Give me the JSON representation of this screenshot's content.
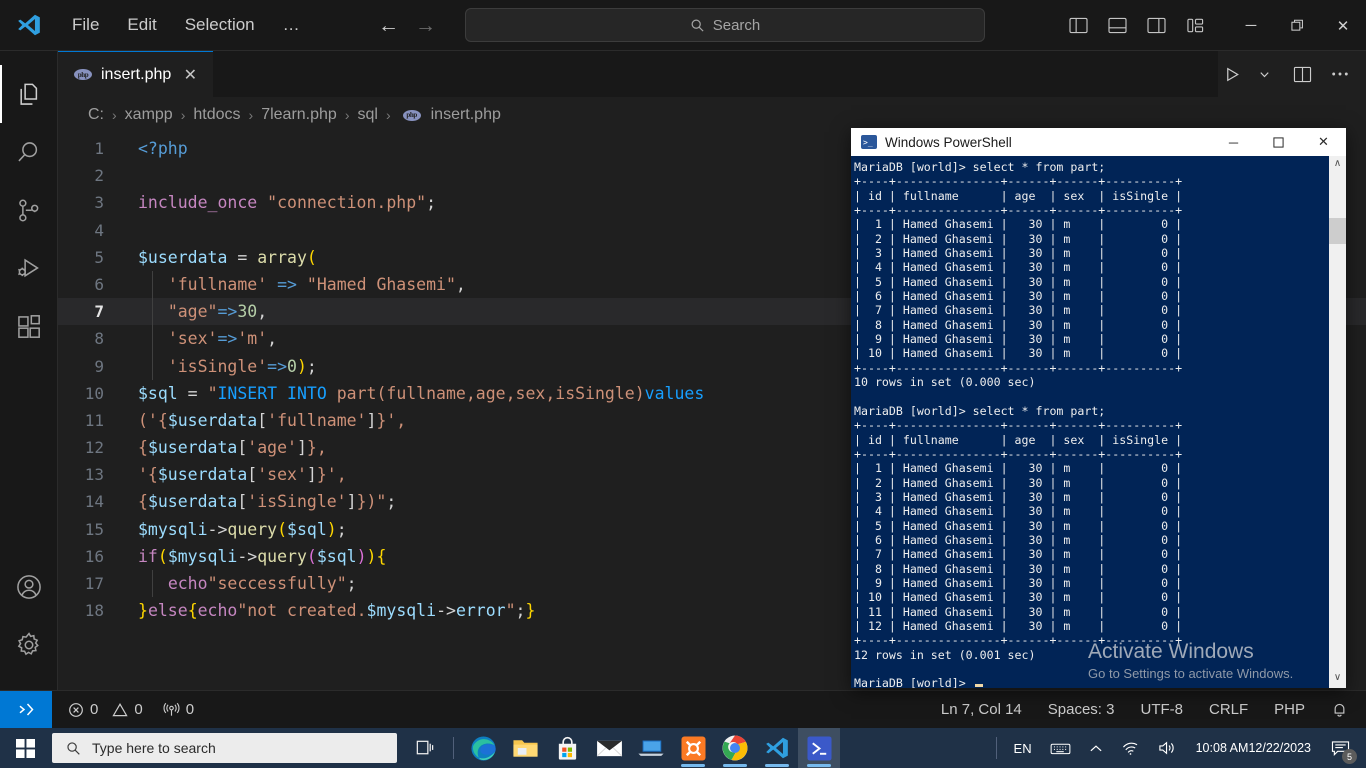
{
  "titlebar": {
    "menu": [
      "File",
      "Edit",
      "Selection",
      "…"
    ],
    "search_placeholder": "Search",
    "search_label": "Search",
    "back_arrow": "←",
    "forward_arrow": "→",
    "minimize": "─",
    "maximize": "❐",
    "close": "✕"
  },
  "activitybar": {
    "items": [
      {
        "name": "explorer",
        "label": "Explorer"
      },
      {
        "name": "search",
        "label": "Search"
      },
      {
        "name": "source-control",
        "label": "Source Control"
      },
      {
        "name": "run-debug",
        "label": "Run and Debug"
      },
      {
        "name": "extensions",
        "label": "Extensions"
      }
    ],
    "bottom": [
      {
        "name": "accounts",
        "label": "Accounts"
      },
      {
        "name": "settings",
        "label": "Manage"
      }
    ]
  },
  "tabs": [
    {
      "label": "insert.php",
      "icon": "php-icon",
      "close": "✕",
      "active": true
    }
  ],
  "breadcrumb": [
    "C:",
    "xampp",
    "htdocs",
    "7learn.php",
    "sql",
    "insert.php"
  ],
  "breadcrumb_separator": "›",
  "editor": {
    "lines": [
      {
        "num": "1",
        "current": false,
        "guide": false,
        "tokens": [
          {
            "c": "t-blue",
            "t": "<?php"
          }
        ]
      },
      {
        "num": "2",
        "current": false,
        "guide": false,
        "tokens": []
      },
      {
        "num": "3",
        "current": false,
        "guide": false,
        "tokens": [
          {
            "c": "t-kw",
            "t": "include_once"
          },
          {
            "c": "t-plain",
            "t": " "
          },
          {
            "c": "t-str",
            "t": "\"connection.php\""
          },
          {
            "c": "t-plain",
            "t": ";"
          }
        ]
      },
      {
        "num": "4",
        "current": false,
        "guide": false,
        "tokens": []
      },
      {
        "num": "5",
        "current": false,
        "guide": false,
        "tokens": [
          {
            "c": "t-var",
            "t": "$userdata"
          },
          {
            "c": "t-plain",
            "t": " = "
          },
          {
            "c": "t-fn",
            "t": "array"
          },
          {
            "c": "t-y",
            "t": "("
          }
        ]
      },
      {
        "num": "6",
        "current": false,
        "guide": true,
        "tokens": [
          {
            "c": "t-plain",
            "t": "   "
          },
          {
            "c": "t-str",
            "t": "'fullname'"
          },
          {
            "c": "t-plain",
            "t": " "
          },
          {
            "c": "t-blue",
            "t": "=>"
          },
          {
            "c": "t-plain",
            "t": " "
          },
          {
            "c": "t-str",
            "t": "\"Hamed Ghasemi\""
          },
          {
            "c": "t-plain",
            "t": ","
          }
        ]
      },
      {
        "num": "7",
        "current": true,
        "guide": true,
        "tokens": [
          {
            "c": "t-plain",
            "t": "   "
          },
          {
            "c": "t-str",
            "t": "\"age\""
          },
          {
            "c": "t-blue",
            "t": "=>"
          },
          {
            "c": "t-num",
            "t": "30"
          },
          {
            "c": "t-plain",
            "t": ","
          }
        ]
      },
      {
        "num": "8",
        "current": false,
        "guide": true,
        "tokens": [
          {
            "c": "t-plain",
            "t": "   "
          },
          {
            "c": "t-str",
            "t": "'sex'"
          },
          {
            "c": "t-blue",
            "t": "=>"
          },
          {
            "c": "t-str",
            "t": "'m'"
          },
          {
            "c": "t-plain",
            "t": ","
          }
        ]
      },
      {
        "num": "9",
        "current": false,
        "guide": true,
        "tokens": [
          {
            "c": "t-plain",
            "t": "   "
          },
          {
            "c": "t-str",
            "t": "'isSingle'"
          },
          {
            "c": "t-blue",
            "t": "=>"
          },
          {
            "c": "t-num",
            "t": "0"
          },
          {
            "c": "t-y",
            "t": ")"
          },
          {
            "c": "t-plain",
            "t": ";"
          }
        ]
      },
      {
        "num": "10",
        "current": false,
        "guide": false,
        "tokens": [
          {
            "c": "t-var",
            "t": "$sql"
          },
          {
            "c": "t-plain",
            "t": " = "
          },
          {
            "c": "t-str",
            "t": "\""
          },
          {
            "c": "t-c",
            "t": "INSERT INTO"
          },
          {
            "c": "t-str",
            "t": " part(fullname,age,sex,isSingle)"
          },
          {
            "c": "t-c",
            "t": "values"
          }
        ]
      },
      {
        "num": "11",
        "current": false,
        "guide": false,
        "tokens": [
          {
            "c": "t-str",
            "t": "('{"
          },
          {
            "c": "t-var",
            "t": "$userdata"
          },
          {
            "c": "t-plain",
            "t": "["
          },
          {
            "c": "t-str",
            "t": "'fullname'"
          },
          {
            "c": "t-plain",
            "t": "]"
          },
          {
            "c": "t-str",
            "t": "}',"
          }
        ]
      },
      {
        "num": "12",
        "current": false,
        "guide": false,
        "tokens": [
          {
            "c": "t-str",
            "t": "{"
          },
          {
            "c": "t-var",
            "t": "$userdata"
          },
          {
            "c": "t-plain",
            "t": "["
          },
          {
            "c": "t-str",
            "t": "'age'"
          },
          {
            "c": "t-plain",
            "t": "]"
          },
          {
            "c": "t-str",
            "t": "},"
          }
        ]
      },
      {
        "num": "13",
        "current": false,
        "guide": false,
        "tokens": [
          {
            "c": "t-str",
            "t": "'{"
          },
          {
            "c": "t-var",
            "t": "$userdata"
          },
          {
            "c": "t-plain",
            "t": "["
          },
          {
            "c": "t-str",
            "t": "'sex'"
          },
          {
            "c": "t-plain",
            "t": "]"
          },
          {
            "c": "t-str",
            "t": "}',"
          }
        ]
      },
      {
        "num": "14",
        "current": false,
        "guide": false,
        "tokens": [
          {
            "c": "t-str",
            "t": "{"
          },
          {
            "c": "t-var",
            "t": "$userdata"
          },
          {
            "c": "t-plain",
            "t": "["
          },
          {
            "c": "t-str",
            "t": "'isSingle'"
          },
          {
            "c": "t-plain",
            "t": "]"
          },
          {
            "c": "t-str",
            "t": "})\""
          },
          {
            "c": "t-plain",
            "t": ";"
          }
        ]
      },
      {
        "num": "15",
        "current": false,
        "guide": false,
        "tokens": [
          {
            "c": "t-var",
            "t": "$mysqli"
          },
          {
            "c": "t-plain",
            "t": "->"
          },
          {
            "c": "t-fn",
            "t": "query"
          },
          {
            "c": "t-y",
            "t": "("
          },
          {
            "c": "t-var",
            "t": "$sql"
          },
          {
            "c": "t-y",
            "t": ")"
          },
          {
            "c": "t-plain",
            "t": ";"
          }
        ]
      },
      {
        "num": "16",
        "current": false,
        "guide": false,
        "tokens": [
          {
            "c": "t-kw",
            "t": "if"
          },
          {
            "c": "t-y",
            "t": "("
          },
          {
            "c": "t-var",
            "t": "$mysqli"
          },
          {
            "c": "t-plain",
            "t": "->"
          },
          {
            "c": "t-fn",
            "t": "query"
          },
          {
            "c": "t-m",
            "t": "("
          },
          {
            "c": "t-var",
            "t": "$sql"
          },
          {
            "c": "t-m",
            "t": ")"
          },
          {
            "c": "t-y",
            "t": ")"
          },
          {
            "c": "t-y",
            "t": "{"
          }
        ]
      },
      {
        "num": "17",
        "current": false,
        "guide": true,
        "tokens": [
          {
            "c": "t-plain",
            "t": "   "
          },
          {
            "c": "t-kw",
            "t": "echo"
          },
          {
            "c": "t-str",
            "t": "\"seccessfully\""
          },
          {
            "c": "t-plain",
            "t": ";"
          }
        ]
      },
      {
        "num": "18",
        "current": false,
        "guide": false,
        "tokens": [
          {
            "c": "t-y",
            "t": "}"
          },
          {
            "c": "t-kw",
            "t": "else"
          },
          {
            "c": "t-y",
            "t": "{"
          },
          {
            "c": "t-kw",
            "t": "echo"
          },
          {
            "c": "t-str",
            "t": "\"not created."
          },
          {
            "c": "t-var",
            "t": "$mysqli"
          },
          {
            "c": "t-plain",
            "t": "->"
          },
          {
            "c": "t-var",
            "t": "error"
          },
          {
            "c": "t-str",
            "t": "\""
          },
          {
            "c": "t-plain",
            "t": ";"
          },
          {
            "c": "t-y",
            "t": "}"
          }
        ]
      }
    ]
  },
  "statusbar": {
    "errors": "0",
    "warnings": "0",
    "ports": "0",
    "position": "Ln 7, Col 14",
    "spaces": "Spaces: 3",
    "encoding": "UTF-8",
    "eol": "CRLF",
    "language": "PHP"
  },
  "powershell": {
    "title": "Windows PowerShell",
    "minimize": "─",
    "maximize": "☐",
    "close": "✕",
    "scroll_up": "∧",
    "scroll_down": "∨",
    "content": "MariaDB [world]> select * from part;\n+----+---------------+------+------+----------+\n| id | fullname      | age  | sex  | isSingle |\n+----+---------------+------+------+----------+\n|  1 | Hamed Ghasemi |   30 | m    |        0 |\n|  2 | Hamed Ghasemi |   30 | m    |        0 |\n|  3 | Hamed Ghasemi |   30 | m    |        0 |\n|  4 | Hamed Ghasemi |   30 | m    |        0 |\n|  5 | Hamed Ghasemi |   30 | m    |        0 |\n|  6 | Hamed Ghasemi |   30 | m    |        0 |\n|  7 | Hamed Ghasemi |   30 | m    |        0 |\n|  8 | Hamed Ghasemi |   30 | m    |        0 |\n|  9 | Hamed Ghasemi |   30 | m    |        0 |\n| 10 | Hamed Ghasemi |   30 | m    |        0 |\n+----+---------------+------+------+----------+\n10 rows in set (0.000 sec)\n\nMariaDB [world]> select * from part;\n+----+---------------+------+------+----------+\n| id | fullname      | age  | sex  | isSingle |\n+----+---------------+------+------+----------+\n|  1 | Hamed Ghasemi |   30 | m    |        0 |\n|  2 | Hamed Ghasemi |   30 | m    |        0 |\n|  3 | Hamed Ghasemi |   30 | m    |        0 |\n|  4 | Hamed Ghasemi |   30 | m    |        0 |\n|  5 | Hamed Ghasemi |   30 | m    |        0 |\n|  6 | Hamed Ghasemi |   30 | m    |        0 |\n|  7 | Hamed Ghasemi |   30 | m    |        0 |\n|  8 | Hamed Ghasemi |   30 | m    |        0 |\n|  9 | Hamed Ghasemi |   30 | m    |        0 |\n| 10 | Hamed Ghasemi |   30 | m    |        0 |\n| 11 | Hamed Ghasemi |   30 | m    |        0 |\n| 12 | Hamed Ghasemi |   30 | m    |        0 |\n+----+---------------+------+------+----------+\n12 rows in set (0.001 sec)\n\nMariaDB [world]> ",
    "watermark_title": "Activate Windows",
    "watermark_sub": "Go to Settings to activate Windows."
  },
  "taskbar": {
    "search_placeholder": "Type here to search",
    "icons": [
      {
        "name": "task-view-icon"
      },
      {
        "name": "edge-icon"
      },
      {
        "name": "file-explorer-icon"
      },
      {
        "name": "microsoft-store-icon"
      },
      {
        "name": "mail-icon"
      },
      {
        "name": "remote-desktop-icon"
      },
      {
        "name": "xampp-icon"
      },
      {
        "name": "chrome-icon"
      },
      {
        "name": "vscode-icon"
      },
      {
        "name": "powershell-icon"
      }
    ],
    "tray": {
      "language": "EN",
      "time": "10:08 AM",
      "date": "12/22/2023",
      "notification_count": "5"
    }
  }
}
